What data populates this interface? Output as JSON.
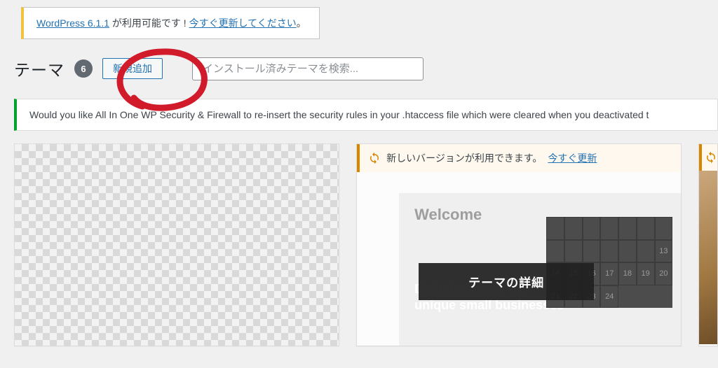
{
  "update_nag": {
    "link_text": "WordPress 6.1.1",
    "middle_text": " が利用可能です ! ",
    "action_link": "今すぐ更新してください",
    "trailing": "。"
  },
  "header": {
    "title": "テーマ",
    "count": "6",
    "add_new_label": "新規追加",
    "search_placeholder": "インストール済みテーマを検索..."
  },
  "security_notice": "Would you like All In One WP Security & Firewall to re-insert the security rules in your .htaccess file which were cleared when you deactivated t",
  "themes": {
    "update_bar": {
      "text": "新しいバージョンが利用できます。",
      "link": "今すぐ更新"
    },
    "preview": {
      "welcome": "Welcome",
      "tagline_line1": "Digital strategy for",
      "tagline_line2": "unique small businesses",
      "calendar_days": [
        "",
        "",
        "",
        "",
        "",
        "",
        "",
        "",
        "",
        "",
        "",
        "",
        "",
        "13",
        "14",
        "15",
        "16",
        "17",
        "18",
        "19",
        "20",
        "21",
        "22",
        "23",
        "24"
      ]
    },
    "details_overlay": "テーマの詳細"
  }
}
